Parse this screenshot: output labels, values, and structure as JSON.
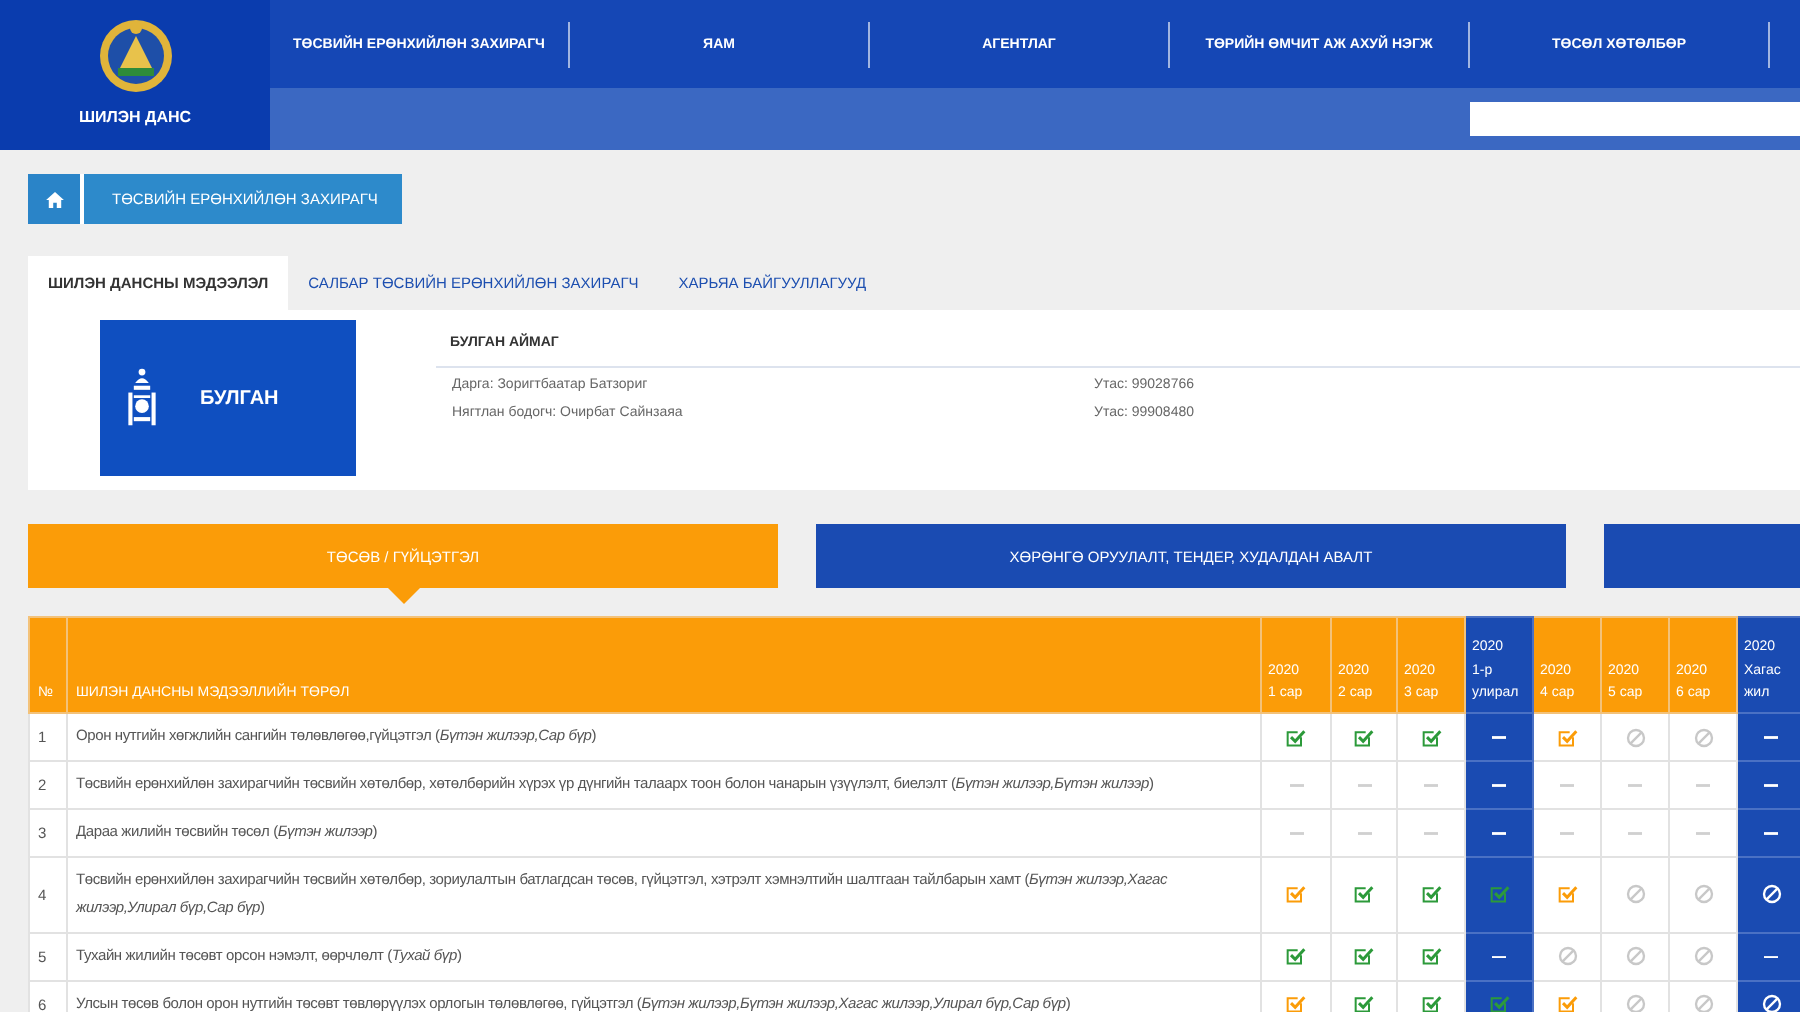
{
  "header": {
    "logo_text": "ШИЛЭН ДАНС",
    "nav": [
      {
        "label": "ТӨСВИЙН ЕРӨНХИЙЛӨН ЗАХИРАГЧ"
      },
      {
        "label": "ЯАМ"
      },
      {
        "label": "АГЕНТЛАГ"
      },
      {
        "label": "ТӨРИЙН ӨМЧИТ АЖ АХУЙ НЭГЖ"
      },
      {
        "label": "ТӨСӨЛ ХӨТӨЛБӨР"
      }
    ]
  },
  "breadcrumb": {
    "label": "ТӨСВИЙН ЕРӨНХИЙЛӨН ЗАХИРАГЧ"
  },
  "tabs": [
    {
      "label": "ШИЛЭН ДАНСНЫ МЭДЭЭЛЭЛ",
      "selected": true
    },
    {
      "label": "САЛБАР ТӨСВИЙН ЕРӨНХИЙЛӨН ЗАХИРАГЧ",
      "selected": false
    },
    {
      "label": "ХАРЬЯА БАЙГУУЛЛАГУУД",
      "selected": false
    }
  ],
  "organization": {
    "badge_label": "БУЛГАН",
    "name": "БУЛГАН АЙМАГ",
    "contacts": [
      {
        "person": "Дарга: Зоригтбаатар Батзориг",
        "phone": "Утас: 99028766"
      },
      {
        "person": "Нягтлан бодогч: Очирбат Сайнзаяа",
        "phone": "Утас: 99908480"
      }
    ]
  },
  "sections": [
    {
      "label": "ТӨСӨВ / ГҮЙЦЭТГЭЛ",
      "selected": true
    },
    {
      "label": "ХӨРӨНГӨ ОРУУЛАЛТ, ТЕНДЕР, ХУДАЛДАН АВАЛТ",
      "selected": false
    },
    {
      "selected": false
    }
  ],
  "table": {
    "number_heading": "№",
    "type_heading": "ШИЛЭН ДАНСНЫ МЭДЭЭЛЛИЙН ТӨРӨЛ",
    "periods": [
      {
        "kind": "month",
        "year": "2020",
        "label": "1 сар"
      },
      {
        "kind": "month",
        "year": "2020",
        "label": "2 сар"
      },
      {
        "kind": "month",
        "year": "2020",
        "label": "3 сар"
      },
      {
        "kind": "quarter",
        "year": "2020",
        "label": "1-р улирал"
      },
      {
        "kind": "month",
        "year": "2020",
        "label": "4 сар"
      },
      {
        "kind": "month",
        "year": "2020",
        "label": "5 сар"
      },
      {
        "kind": "month",
        "year": "2020",
        "label": "6 сар"
      },
      {
        "kind": "half",
        "year": "2020",
        "label": "Хагас жил"
      }
    ],
    "rows": [
      {
        "number": "1",
        "text": "Орон нутгийн хөгжлийн сангийн төлөвлөгөө,гүйцэтгэл (*Бүтэн жилээр,Сар бүр*)",
        "statuses": [
          {
            "kind": "ok"
          },
          {
            "kind": "ok"
          },
          {
            "kind": "ok"
          },
          {
            "kind": "na"
          },
          {
            "kind": "late"
          },
          {
            "kind": "none"
          },
          {
            "kind": "none"
          },
          {
            "kind": "na"
          }
        ]
      },
      {
        "number": "2",
        "text": "Төсвийн ерөнхийлөн захирагчийн төсвийн хөтөлбөр, хөтөлбөрийн хүрэх үр дүнгийн талаарх тоон болон чанарын үзүүлэлт, биелэлт (*Бүтэн жилээр,Бүтэн жилээр*)",
        "statuses": [
          {
            "kind": "na"
          },
          {
            "kind": "na"
          },
          {
            "kind": "na"
          },
          {
            "kind": "na"
          },
          {
            "kind": "na"
          },
          {
            "kind": "na"
          },
          {
            "kind": "na"
          },
          {
            "kind": "na"
          }
        ]
      },
      {
        "number": "3",
        "text": "Дараа жилийн төсвийн төсөл (*Бүтэн жилээр*)",
        "statuses": [
          {
            "kind": "na"
          },
          {
            "kind": "na"
          },
          {
            "kind": "na"
          },
          {
            "kind": "na"
          },
          {
            "kind": "na"
          },
          {
            "kind": "na"
          },
          {
            "kind": "na"
          },
          {
            "kind": "na"
          }
        ]
      },
      {
        "number": "4",
        "text": "Төсвийн ерөнхийлөн захирагчийн төсвийн хөтөлбөр, зориулалтын батлагдсан төсөв, гүйцэтгэл, хэтрэлт хэмнэлтийн шалтгаан тайлбарын хамт (*Бүтэн жилээр,Хагас жилээр,Улирал бүр,Сар бүр*)",
        "statuses": [
          {
            "kind": "late"
          },
          {
            "kind": "ok"
          },
          {
            "kind": "ok"
          },
          {
            "kind": "ok"
          },
          {
            "kind": "late"
          },
          {
            "kind": "none"
          },
          {
            "kind": "none"
          },
          {
            "kind": "none"
          }
        ]
      },
      {
        "number": "5",
        "text": "Тухайн жилийн төсөвт орсон нэмэлт, өөрчлөлт (*Тухай бүр*)",
        "statuses": [
          {
            "kind": "ok"
          },
          {
            "kind": "ok"
          },
          {
            "kind": "ok"
          },
          {
            "kind": "na"
          },
          {
            "kind": "none"
          },
          {
            "kind": "none"
          },
          {
            "kind": "none"
          },
          {
            "kind": "na"
          }
        ]
      },
      {
        "number": "6",
        "text": "Улсын төсөв болон орон нутгийн төсөвт төвлөрүүлэх орлогын төлөвлөгөө, гүйцэтгэл (*Бүтэн жилээр,Бүтэн жилээр,Хагас жилээр,Улирал бүр,Сар бүр*)",
        "statuses": [
          {
            "kind": "late"
          },
          {
            "kind": "ok"
          },
          {
            "kind": "ok"
          },
          {
            "kind": "ok"
          },
          {
            "kind": "late"
          },
          {
            "kind": "none"
          },
          {
            "kind": "none"
          },
          {
            "kind": "none"
          }
        ]
      }
    ]
  }
}
